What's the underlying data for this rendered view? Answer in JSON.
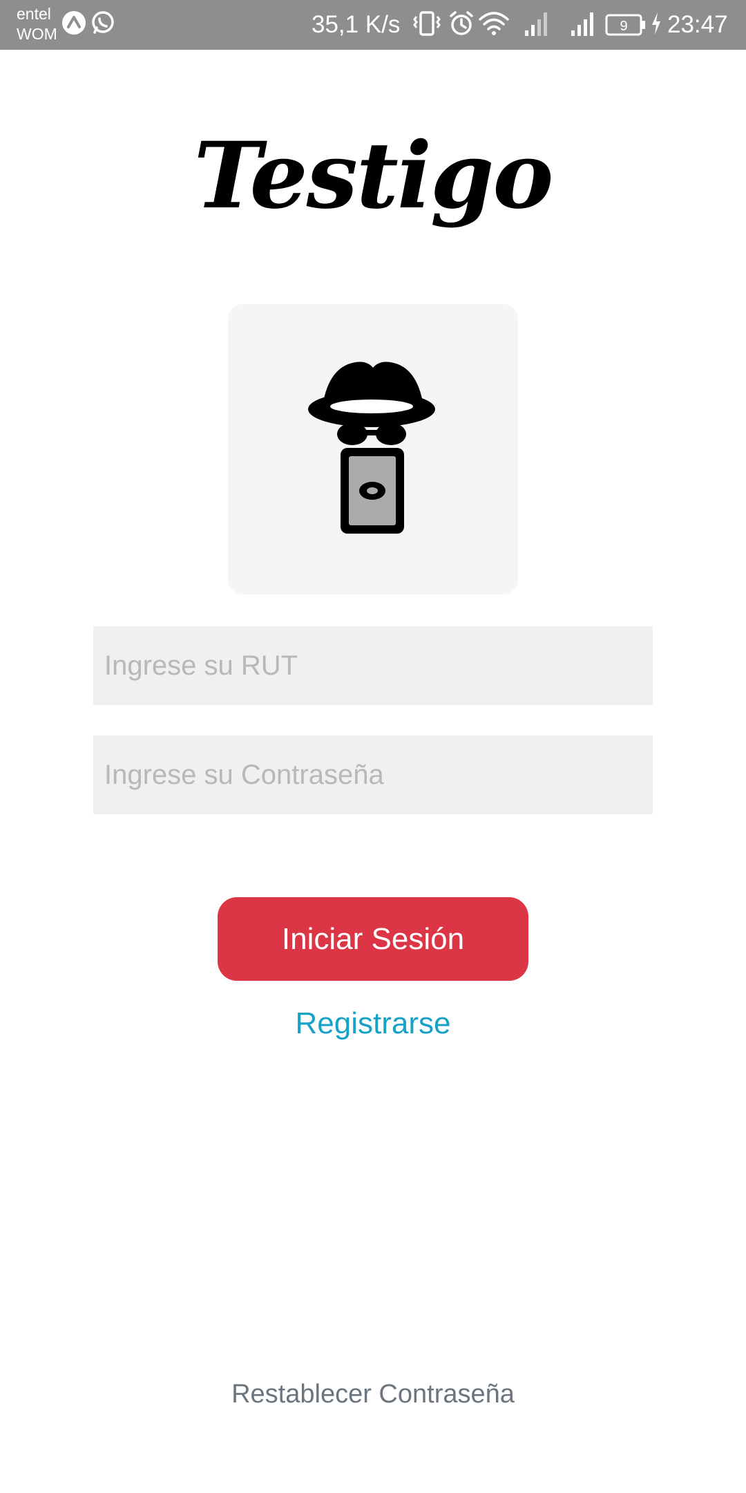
{
  "status_bar": {
    "carrier_1": "entel",
    "carrier_2": "WOM",
    "network_speed": "35,1 K/s",
    "battery_level": "9",
    "time": "23:47",
    "icons": [
      "app-a-icon",
      "whatsapp-icon",
      "vibrate-icon",
      "alarm-icon",
      "wifi-icon",
      "signal-icon",
      "signal-icon",
      "battery-icon",
      "charging-icon"
    ]
  },
  "app": {
    "title": "Testigo",
    "logo_icon": "spy-phone-icon"
  },
  "form": {
    "rut_placeholder": "Ingrese su RUT",
    "rut_value": "",
    "password_placeholder": "Ingrese su Contraseña",
    "password_value": "",
    "login_label": "Iniciar Sesión",
    "register_label": "Registrarse",
    "reset_password_label": "Restablecer Contraseña"
  },
  "colors": {
    "primary_button": "#dc3545",
    "link": "#17a2c8",
    "secondary_text": "#6c757d",
    "status_bar": "#8e8e8e"
  }
}
